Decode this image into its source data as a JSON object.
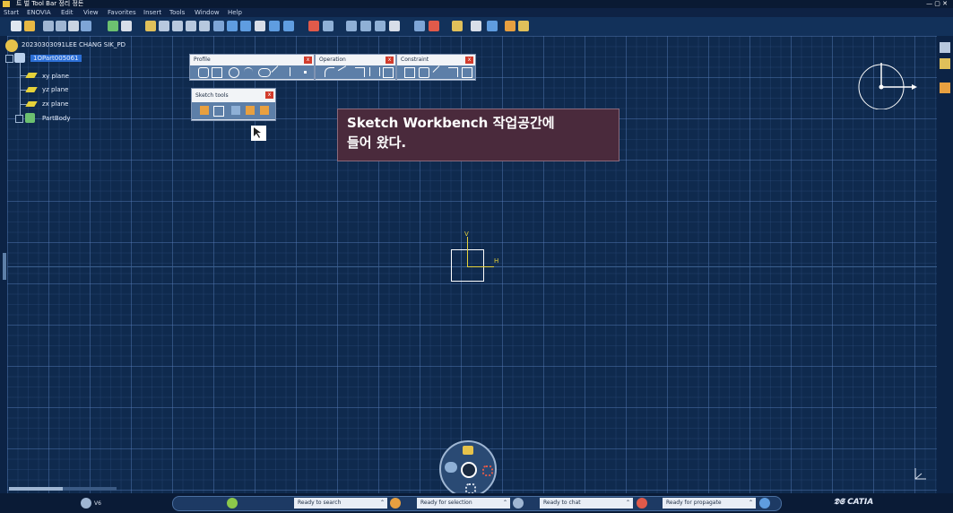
{
  "window": {
    "title": "트 벌 Tool Bar 정리 정돈"
  },
  "menu": {
    "items": [
      "Start",
      "ENOVIA",
      "Edit",
      "View",
      "Favorites",
      "Insert",
      "Tools",
      "Window",
      "Help"
    ]
  },
  "tree": {
    "root": "20230303091LEE CHANG SIK_PD",
    "part": "1OPart005061",
    "planes": [
      "xy plane",
      "yz plane",
      "zx plane"
    ],
    "body": "PartBody"
  },
  "toolbars": {
    "profile": {
      "title": "Profile"
    },
    "operation": {
      "title": "Operation"
    },
    "constraint": {
      "title": "Constraint"
    },
    "sketch_tools": {
      "title": "Sketch tools"
    }
  },
  "callout": {
    "line1": "Sketch Workbench 작업공간에",
    "line2": "들어 왔다."
  },
  "axes": {
    "v": "V",
    "h": "H"
  },
  "status": {
    "search": "Ready to search",
    "selection": "Ready for selection",
    "chat": "Ready to chat",
    "propagate": "Ready for propagate",
    "brand": "CATIA",
    "v6": "V6"
  },
  "colors": {
    "canvas": "#0f2a4e",
    "callout_bg": "#4a2a3c",
    "close_red": "#d23c2c",
    "axis_yellow": "#e6d23a"
  }
}
